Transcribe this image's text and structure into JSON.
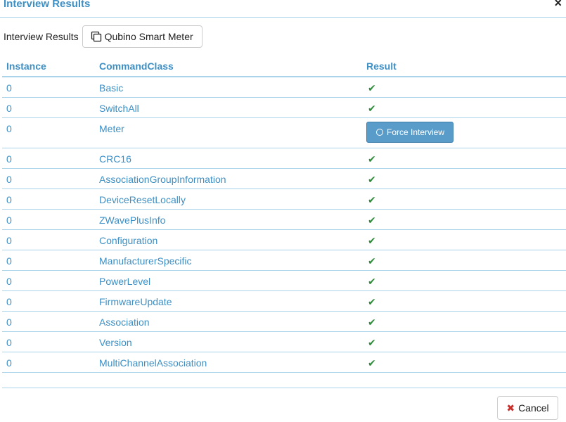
{
  "dialog": {
    "title": "Interview Results",
    "close_glyph": "×"
  },
  "device": {
    "label": "Interview Results",
    "name": "Qubino Smart Meter"
  },
  "table": {
    "headers": {
      "instance": "Instance",
      "command_class": "CommandClass",
      "result": "Result"
    },
    "rows": [
      {
        "instance": "0",
        "command_class": "Basic",
        "result": "ok"
      },
      {
        "instance": "0",
        "command_class": "SwitchAll",
        "result": "ok"
      },
      {
        "instance": "0",
        "command_class": "Meter",
        "result": "Force Interview"
      },
      {
        "instance": "0",
        "command_class": "CRC16",
        "result": "ok"
      },
      {
        "instance": "0",
        "command_class": "AssociationGroupInformation",
        "result": "ok"
      },
      {
        "instance": "0",
        "command_class": "DeviceResetLocally",
        "result": "ok"
      },
      {
        "instance": "0",
        "command_class": "ZWavePlusInfo",
        "result": "ok"
      },
      {
        "instance": "0",
        "command_class": "Configuration",
        "result": "ok"
      },
      {
        "instance": "0",
        "command_class": "ManufacturerSpecific",
        "result": "ok"
      },
      {
        "instance": "0",
        "command_class": "PowerLevel",
        "result": "ok"
      },
      {
        "instance": "0",
        "command_class": "FirmwareUpdate",
        "result": "ok"
      },
      {
        "instance": "0",
        "command_class": "Association",
        "result": "ok"
      },
      {
        "instance": "0",
        "command_class": "Version",
        "result": "ok"
      },
      {
        "instance": "0",
        "command_class": "MultiChannelAssociation",
        "result": "ok"
      }
    ]
  },
  "footer": {
    "cancel_label": "Cancel"
  },
  "colors": {
    "accent": "#3d8fc4",
    "check": "#2e8b3a",
    "force_button": "#5a9cc9",
    "cancel_icon": "#c9302c"
  }
}
